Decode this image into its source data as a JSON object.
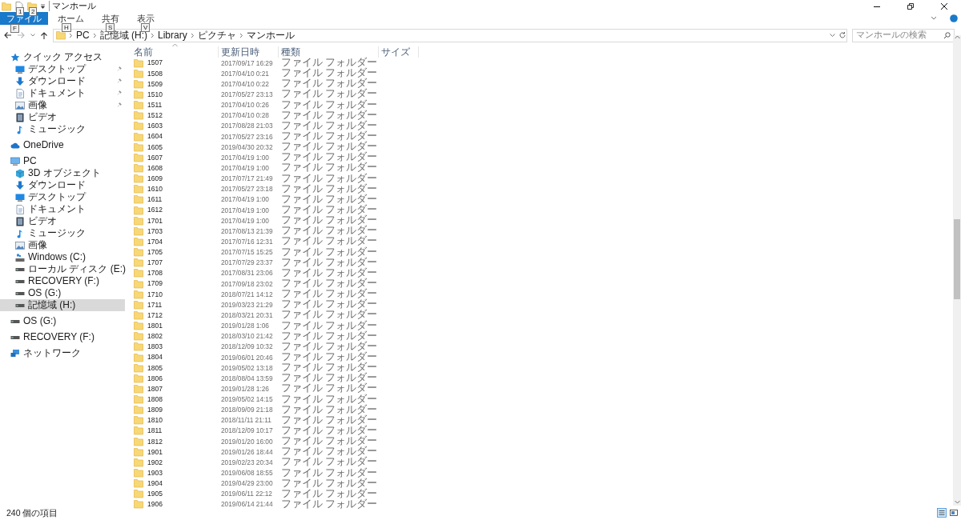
{
  "window": {
    "title": "マンホール"
  },
  "quick_access_toolbar": [
    {
      "keytip": "1"
    },
    {
      "keytip": "2"
    }
  ],
  "ribbon_tabs": [
    {
      "label": "ファイル",
      "kind": "file",
      "keytip": "F"
    },
    {
      "label": "ホーム",
      "kind": "tab",
      "keytip": "H"
    },
    {
      "label": "共有",
      "kind": "tab",
      "keytip": "S"
    },
    {
      "label": "表示",
      "kind": "tab",
      "keytip": "V"
    }
  ],
  "address_bar": {
    "path": [
      "PC",
      "記憶域 (H:)",
      "Library",
      "ピクチャ",
      "マンホール"
    ]
  },
  "search": {
    "placeholder": "マンホールの検索"
  },
  "nav_pane": [
    {
      "label": "クイック アクセス",
      "kind": "star",
      "selected": false,
      "children": [
        {
          "label": "デスクトップ",
          "kind": "desktop",
          "pinned": true,
          "selected": false
        },
        {
          "label": "ダウンロード",
          "kind": "download",
          "pinned": true,
          "selected": false
        },
        {
          "label": "ドキュメント",
          "kind": "document",
          "pinned": true,
          "selected": false
        },
        {
          "label": "画像",
          "kind": "pictures",
          "pinned": true,
          "selected": false
        },
        {
          "label": "ビデオ",
          "kind": "video",
          "pinned": false,
          "selected": false
        },
        {
          "label": "ミュージック",
          "kind": "music",
          "pinned": false,
          "selected": false
        }
      ]
    },
    {
      "label": "OneDrive",
      "kind": "cloud",
      "selected": false
    },
    {
      "label": "PC",
      "kind": "pc",
      "selected": false,
      "children": [
        {
          "label": "3D オブジェクト",
          "kind": "cube",
          "selected": false
        },
        {
          "label": "ダウンロード",
          "kind": "download",
          "selected": false
        },
        {
          "label": "デスクトップ",
          "kind": "desktop",
          "selected": false
        },
        {
          "label": "ドキュメント",
          "kind": "document",
          "selected": false
        },
        {
          "label": "ビデオ",
          "kind": "video",
          "selected": false
        },
        {
          "label": "ミュージック",
          "kind": "music",
          "selected": false
        },
        {
          "label": "画像",
          "kind": "pictures",
          "selected": false
        },
        {
          "label": "Windows (C:)",
          "kind": "system-drive",
          "selected": false
        },
        {
          "label": "ローカル ディスク (E:)",
          "kind": "drive",
          "selected": false
        },
        {
          "label": "RECOVERY (F:)",
          "kind": "drive",
          "selected": false
        },
        {
          "label": "OS (G:)",
          "kind": "drive",
          "selected": false
        },
        {
          "label": "記憶域 (H:)",
          "kind": "drive",
          "selected": true
        }
      ]
    },
    {
      "label": "OS (G:)",
      "kind": "drive",
      "selected": false
    },
    {
      "label": "RECOVERY (F:)",
      "kind": "drive",
      "selected": false
    },
    {
      "label": "ネットワーク",
      "kind": "network",
      "selected": false
    }
  ],
  "file_list": {
    "columns": [
      {
        "label": "名前",
        "sorted": true
      },
      {
        "label": "更新日時",
        "sorted": false
      },
      {
        "label": "種類",
        "sorted": false
      },
      {
        "label": "サイズ",
        "sorted": false
      }
    ],
    "rows": [
      {
        "name": "1507",
        "modified": "2017/09/17 16:29",
        "type": "ファイル フォルダー"
      },
      {
        "name": "1508",
        "modified": "2017/04/10 0:21",
        "type": "ファイル フォルダー"
      },
      {
        "name": "1509",
        "modified": "2017/04/10 0:22",
        "type": "ファイル フォルダー"
      },
      {
        "name": "1510",
        "modified": "2017/05/27 23:13",
        "type": "ファイル フォルダー"
      },
      {
        "name": "1511",
        "modified": "2017/04/10 0:26",
        "type": "ファイル フォルダー"
      },
      {
        "name": "1512",
        "modified": "2017/04/10 0:28",
        "type": "ファイル フォルダー"
      },
      {
        "name": "1603",
        "modified": "2017/08/28 21:03",
        "type": "ファイル フォルダー"
      },
      {
        "name": "1604",
        "modified": "2017/05/27 23:16",
        "type": "ファイル フォルダー"
      },
      {
        "name": "1605",
        "modified": "2019/04/30 20:32",
        "type": "ファイル フォルダー"
      },
      {
        "name": "1607",
        "modified": "2017/04/19 1:00",
        "type": "ファイル フォルダー"
      },
      {
        "name": "1608",
        "modified": "2017/04/19 1:00",
        "type": "ファイル フォルダー"
      },
      {
        "name": "1609",
        "modified": "2017/07/17 21:49",
        "type": "ファイル フォルダー"
      },
      {
        "name": "1610",
        "modified": "2017/05/27 23:18",
        "type": "ファイル フォルダー"
      },
      {
        "name": "1611",
        "modified": "2017/04/19 1:00",
        "type": "ファイル フォルダー"
      },
      {
        "name": "1612",
        "modified": "2017/04/19 1:00",
        "type": "ファイル フォルダー"
      },
      {
        "name": "1701",
        "modified": "2017/04/19 1:00",
        "type": "ファイル フォルダー"
      },
      {
        "name": "1703",
        "modified": "2017/08/13 21:39",
        "type": "ファイル フォルダー"
      },
      {
        "name": "1704",
        "modified": "2017/07/16 12:31",
        "type": "ファイル フォルダー"
      },
      {
        "name": "1705",
        "modified": "2017/07/15 15:25",
        "type": "ファイル フォルダー"
      },
      {
        "name": "1707",
        "modified": "2017/07/29 23:37",
        "type": "ファイル フォルダー"
      },
      {
        "name": "1708",
        "modified": "2017/08/31 23:06",
        "type": "ファイル フォルダー"
      },
      {
        "name": "1709",
        "modified": "2017/09/18 23:02",
        "type": "ファイル フォルダー"
      },
      {
        "name": "1710",
        "modified": "2018/07/21 14:12",
        "type": "ファイル フォルダー"
      },
      {
        "name": "1711",
        "modified": "2019/03/23 21:29",
        "type": "ファイル フォルダー"
      },
      {
        "name": "1712",
        "modified": "2018/03/21 20:31",
        "type": "ファイル フォルダー"
      },
      {
        "name": "1801",
        "modified": "2019/01/28 1:06",
        "type": "ファイル フォルダー"
      },
      {
        "name": "1802",
        "modified": "2018/03/10 21:42",
        "type": "ファイル フォルダー"
      },
      {
        "name": "1803",
        "modified": "2018/12/09 10:32",
        "type": "ファイル フォルダー"
      },
      {
        "name": "1804",
        "modified": "2019/06/01 20:46",
        "type": "ファイル フォルダー"
      },
      {
        "name": "1805",
        "modified": "2019/05/02 13:18",
        "type": "ファイル フォルダー"
      },
      {
        "name": "1806",
        "modified": "2018/08/04 13:59",
        "type": "ファイル フォルダー"
      },
      {
        "name": "1807",
        "modified": "2019/01/28 1:26",
        "type": "ファイル フォルダー"
      },
      {
        "name": "1808",
        "modified": "2019/05/02 14:15",
        "type": "ファイル フォルダー"
      },
      {
        "name": "1809",
        "modified": "2018/09/09 21:18",
        "type": "ファイル フォルダー"
      },
      {
        "name": "1810",
        "modified": "2018/11/11 21:11",
        "type": "ファイル フォルダー"
      },
      {
        "name": "1811",
        "modified": "2018/12/09 10:17",
        "type": "ファイル フォルダー"
      },
      {
        "name": "1812",
        "modified": "2019/01/20 16:00",
        "type": "ファイル フォルダー"
      },
      {
        "name": "1901",
        "modified": "2019/01/26 18:44",
        "type": "ファイル フォルダー"
      },
      {
        "name": "1902",
        "modified": "2019/02/23 20:34",
        "type": "ファイル フォルダー"
      },
      {
        "name": "1903",
        "modified": "2019/06/08 18:55",
        "type": "ファイル フォルダー"
      },
      {
        "name": "1904",
        "modified": "2019/04/29 23:00",
        "type": "ファイル フォルダー"
      },
      {
        "name": "1905",
        "modified": "2019/06/11 22:12",
        "type": "ファイル フォルダー"
      },
      {
        "name": "1906",
        "modified": "2019/06/14 21:44",
        "type": "ファイル フォルダー"
      }
    ]
  },
  "status_bar": {
    "item_count": "240 個の項目"
  }
}
